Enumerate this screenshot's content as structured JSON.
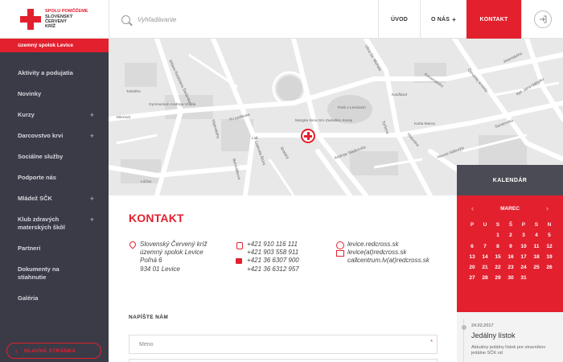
{
  "header": {
    "logo_lines": [
      "SPOLU POMÔŽEME",
      "SLOVENSKÝ",
      "ČERVENÝ",
      "KRÍŽ"
    ],
    "search_placeholder": "Vyhľadávanie",
    "nav": {
      "home": "ÚVOD",
      "about": "O NÁS",
      "about_plus": "+",
      "contact": "KONTAKT"
    },
    "login_icon": "login-arrow-icon"
  },
  "sidebar": {
    "branch": "územný spolok Levice",
    "items": [
      {
        "label": "Aktivity a podujatia",
        "plus": ""
      },
      {
        "label": "Novinky",
        "plus": ""
      },
      {
        "label": "Kurzy",
        "plus": "+"
      },
      {
        "label": "Darcovstvo krvi",
        "plus": "+"
      },
      {
        "label": "Sociálne služby",
        "plus": ""
      },
      {
        "label": "Podporte nás",
        "plus": ""
      },
      {
        "label": "Mládež SČK",
        "plus": "+"
      },
      {
        "label": "Klub zdravých materských škôl",
        "plus": "+"
      },
      {
        "label": "Partneri",
        "plus": ""
      },
      {
        "label": "Dokumenty na stiahnutie",
        "plus": ""
      },
      {
        "label": "Galéria",
        "plus": ""
      }
    ],
    "home_button": "HLAVNÁ STRÁNKA"
  },
  "map": {
    "labels": [
      "Tolstého",
      "Gymnazium Andreja Vrábla",
      "Mierová",
      "Milana Rastislava Štefánika",
      "Pri podlavke",
      "Vajanského",
      "Ľudovíta Štúra",
      "Margita Ilona Sro Zadalsko Kemp",
      "Park v Leviciach",
      "Kaufland",
      "Lidl",
      "Saratovská",
      "Jesenského",
      "Komenského",
      "Kpt. Jána Nálepku",
      "Ulica Sv. Michala",
      "Bernolákova",
      "Lúčna",
      "Červenej armády",
      "Andreja Sládkoviča",
      "Tyršova",
      "Hviezdna",
      "Karla Marxa",
      "Hlavné Nábrežie",
      "Bratská"
    ]
  },
  "content": {
    "title": "KONTAKT",
    "address": [
      "Slovenský Červený kríž",
      "územný spolok Levice",
      "Poľná 6",
      "934 01 Levice"
    ],
    "phones": [
      "+421 910 116 111",
      "+421 903 558 911"
    ],
    "fax": [
      "+421 36 6307 900",
      "+421 36 6312 957"
    ],
    "web": "levice.redcross.sk",
    "emails": [
      "levice(at)redcross.sk",
      "callcentrum.lv(at)redcross.sk"
    ],
    "write_label": "NAPÍŠTE NÁM",
    "name_placeholder": "Meno",
    "required_mark": "*"
  },
  "calendar": {
    "title": "KALENDÁR",
    "month": "MAREC",
    "prev": "‹",
    "next": "›",
    "dow": [
      "P",
      "U",
      "S",
      "Š",
      "P",
      "S",
      "N"
    ],
    "days": [
      "",
      "",
      "1",
      "2",
      "3",
      "4",
      "5",
      "6",
      "7",
      "8",
      "9",
      "10",
      "11",
      "12",
      "13",
      "14",
      "15",
      "16",
      "17",
      "18",
      "19",
      "20",
      "21",
      "22",
      "23",
      "24",
      "25",
      "26",
      "27",
      "28",
      "29",
      "30",
      "31",
      "",
      "",
      ""
    ]
  },
  "event": {
    "date": "24.02.2017",
    "title": "Jedálny lístok",
    "text": "Aktuálny jedálny lístok pre stravníkov jedálne SČK od"
  },
  "colors": {
    "brand_red": "#e3202e",
    "sidebar_bg": "#3b3b47",
    "calendar_head": "#4b4b55"
  }
}
